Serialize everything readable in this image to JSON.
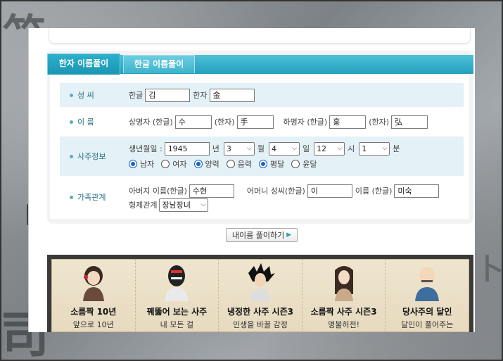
{
  "tabs": [
    {
      "label": "한자 이름풀이",
      "active": true
    },
    {
      "label": "한글 이름풀이",
      "active": false
    }
  ],
  "surname": {
    "label": "성 씨",
    "hangul_label": "한글",
    "hangul_value": "김",
    "hanja_label": "한자",
    "hanja_value": "金"
  },
  "name": {
    "label": "이 름",
    "upper_label": "상명자 (한글)",
    "upper_hangul": "수",
    "upper_hanja_label": "(한자)",
    "upper_hanja": "手",
    "lower_label": "하명자 (한글)",
    "lower_hangul": "홍",
    "lower_hanja_label": "(한자)",
    "lower_hanja": "弘"
  },
  "saju": {
    "label": "사주정보",
    "birth_label": "생년월일 :",
    "year": "1945",
    "year_unit": "년",
    "month": "3",
    "month_unit": "월",
    "day": "4",
    "day_unit": "일",
    "hour": "12",
    "hour_unit": "시",
    "minute": "1",
    "minute_unit": "분",
    "gender_options": [
      {
        "label": "남자",
        "checked": true
      },
      {
        "label": "여자",
        "checked": false
      }
    ],
    "calendar_options": [
      {
        "label": "양력",
        "checked": true
      },
      {
        "label": "음력",
        "checked": false
      }
    ],
    "leap_options": [
      {
        "label": "평달",
        "checked": true
      },
      {
        "label": "윤달",
        "checked": false
      }
    ]
  },
  "family": {
    "label": "가족관계",
    "father_label": "아버지 이름(한글)",
    "father_value": "수현",
    "mother_surname_label": "어머니 성씨(한글)",
    "mother_surname_value": "이",
    "mother_name_label": "이름 (한글)",
    "mother_name_value": "미숙",
    "sibling_label": "형제관계",
    "sibling_value": "장남장녀"
  },
  "submit_label": "내이름 풀이하기",
  "banner_cards": [
    {
      "title": "소름짝 10년",
      "subtitle": "앞으로 10년",
      "icon": "woman-fortune-teller"
    },
    {
      "title": "꿰뚫어 보는 사주",
      "subtitle": "내 모든 걸",
      "icon": "masked-figure"
    },
    {
      "title": "냉정한 사주 시즌3",
      "subtitle": "인생을 바꿀 감정",
      "icon": "spiky-hair-man"
    },
    {
      "title": "소름짝 사주 시즌3",
      "subtitle": "명불허전!",
      "icon": "long-hair-woman"
    },
    {
      "title": "당사주의 달인",
      "subtitle": "달인이 풀어주는",
      "icon": "bald-scholar"
    }
  ],
  "colors": {
    "tab_teal": "#23a0bc",
    "row_shade": "#e4f1f6",
    "label_text": "#2a6f86",
    "radio_blue": "#1a62c9"
  }
}
